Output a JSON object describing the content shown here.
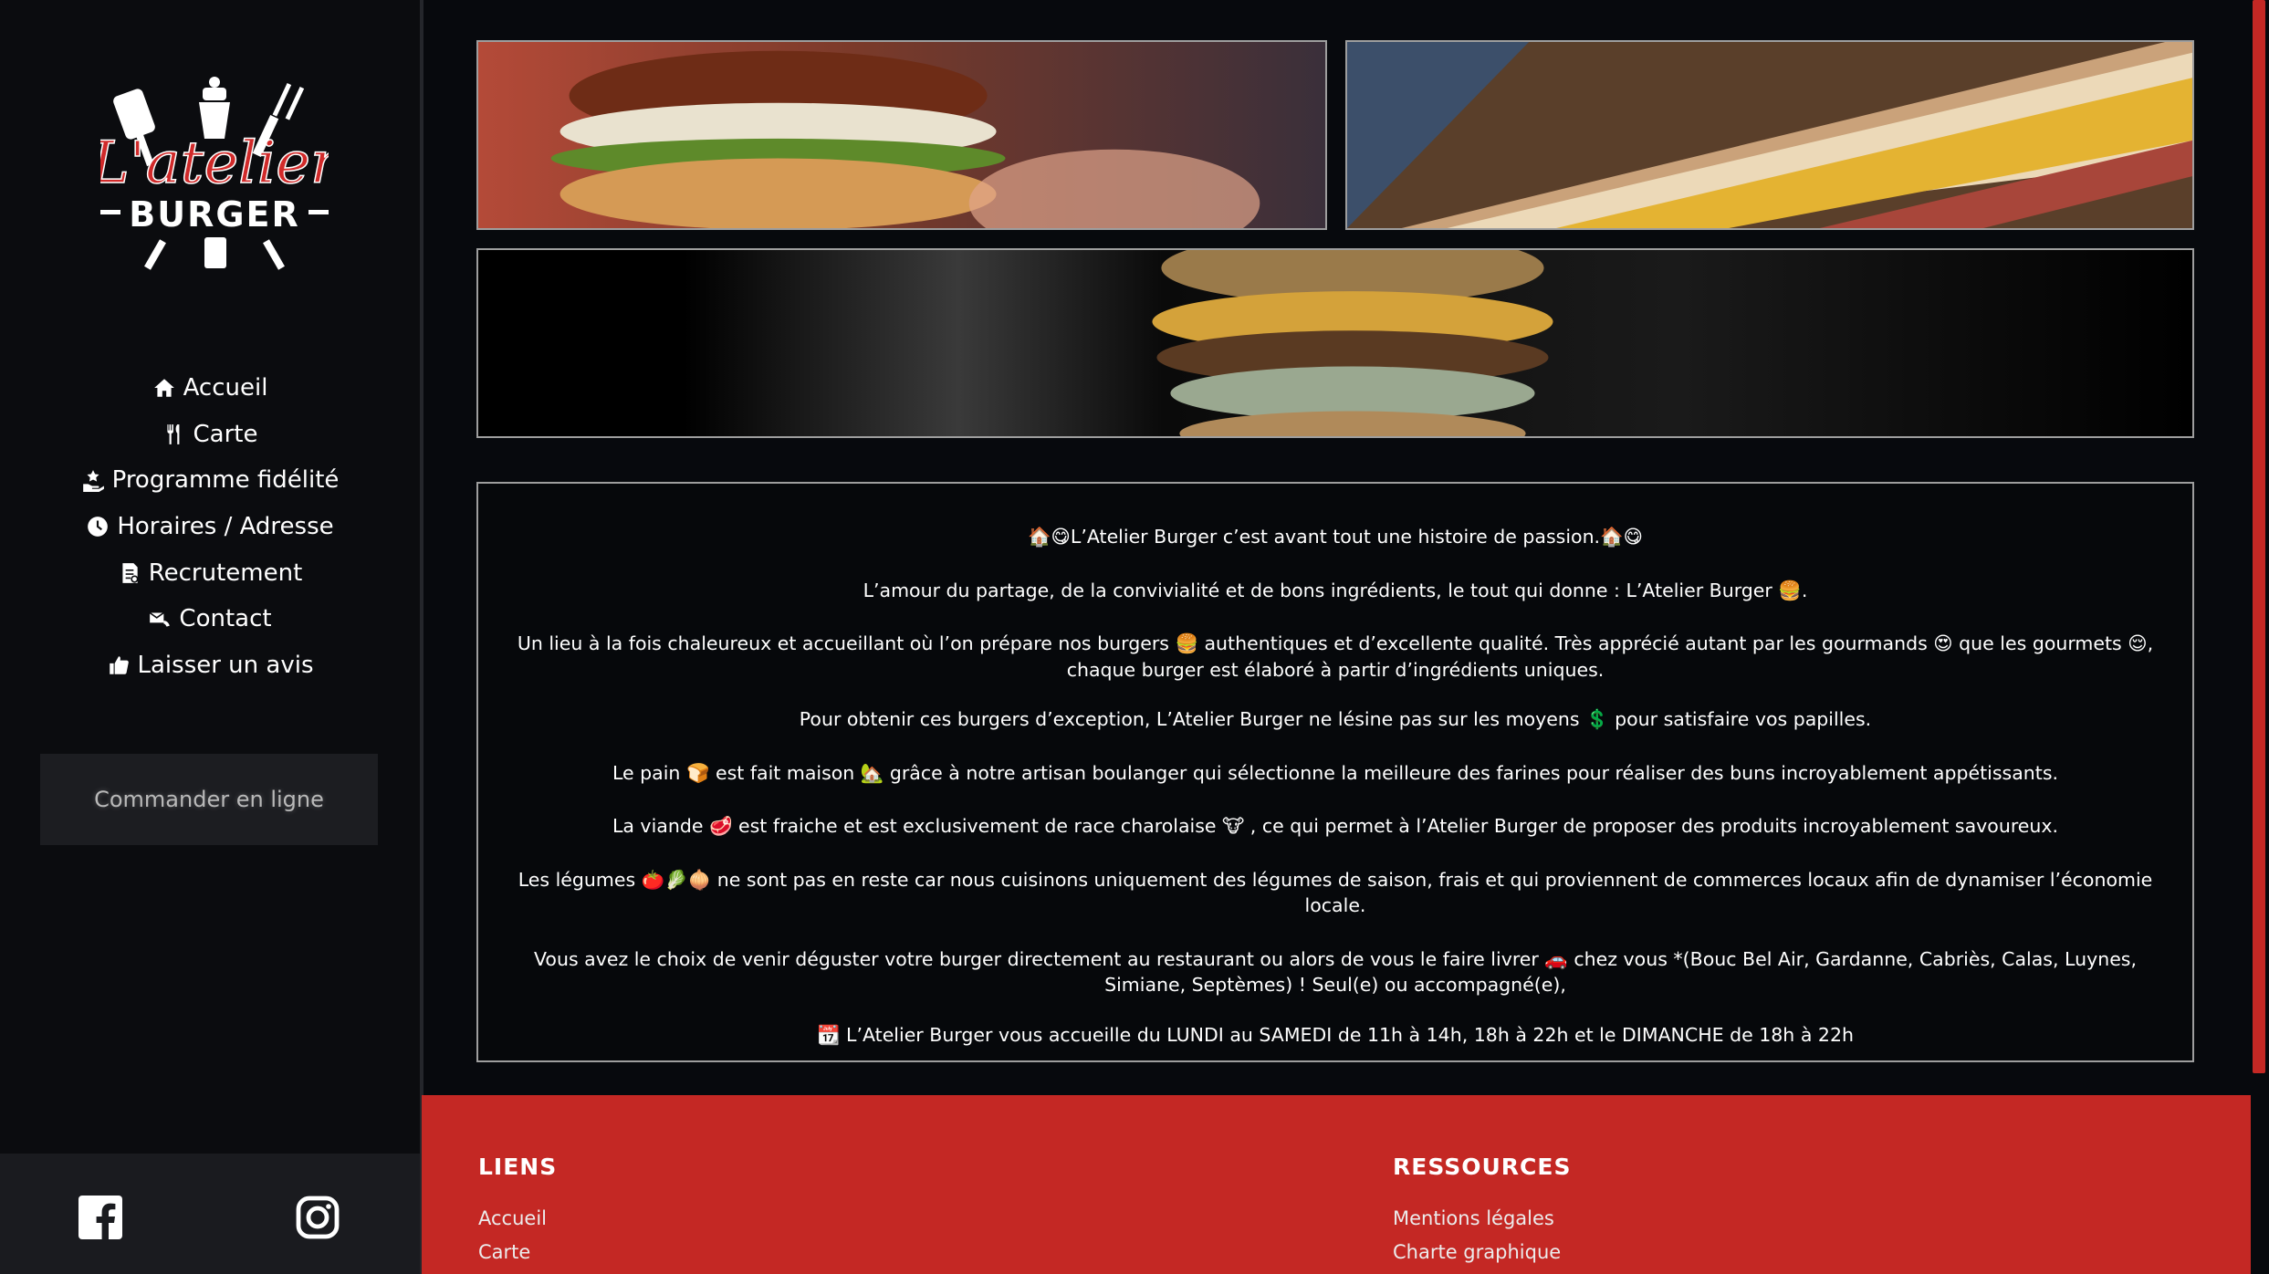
{
  "brand": {
    "logo_script": "L'atelier",
    "logo_word": "BURGER"
  },
  "nav": [
    {
      "label": "Accueil",
      "icon": "home-icon"
    },
    {
      "label": "Carte",
      "icon": "cutlery-icon"
    },
    {
      "label": "Programme fidélité",
      "icon": "loyalty-icon"
    },
    {
      "label": "Horaires / Adresse",
      "icon": "clock-icon"
    },
    {
      "label": "Recrutement",
      "icon": "resume-icon"
    },
    {
      "label": "Contact",
      "icon": "contact-icon"
    },
    {
      "label": "Laisser un avis",
      "icon": "review-icon"
    }
  ],
  "order_button": "Commander en ligne",
  "social": {
    "facebook": "facebook-icon",
    "instagram": "instagram-icon"
  },
  "story": {
    "p1": "🏠😋L’Atelier Burger c’est avant tout une histoire de passion.🏠😋",
    "p2": "L’amour du partage, de la convivialité et de bons ingrédients, le tout qui donne : L’Atelier Burger 🍔.",
    "p3": "Un lieu à la fois chaleureux et accueillant où l’on prépare nos burgers 🍔 authentiques et d’excellente qualité. Très apprécié autant par les gourmands 😍 que les gourmets 😌, chaque burger est élaboré à partir d’ingrédients uniques.",
    "p4": "Pour obtenir ces burgers d’exception, L’Atelier Burger ne lésine pas sur les moyens 💲 pour satisfaire vos papilles.",
    "p5": "Le pain 🍞 est fait maison 🏡 grâce à notre artisan boulanger qui sélectionne la meilleure des farines pour réaliser des buns incroyablement appétissants.",
    "p6": "La viande 🥩 est fraiche et est exclusivement de race charolaise 🐮 , ce qui permet à l’Atelier Burger de proposer des produits incroyablement savoureux.",
    "p7": "Les légumes 🍅🥬🧅 ne sont pas en reste car nous cuisinons uniquement des légumes de saison, frais et qui proviennent de commerces locaux afin de dynamiser l’économie locale.",
    "p8": "Vous avez le choix de venir déguster votre burger directement au restaurant ou alors de vous le faire livrer 🚗 chez vous *(Bouc Bel Air, Gardanne, Cabriès, Calas, Luynes, Simiane, Septèmes) ! Seul(e) ou accompagné(e),",
    "p9": "📆 L’Atelier Burger vous accueille du LUNDI au SAMEDI de 11h à 14h, 18h à 22h et le DIMANCHE de 18h à 22h"
  },
  "footer": {
    "liens": {
      "title": "LIENS",
      "links": [
        "Accueil",
        "Carte"
      ]
    },
    "ressources": {
      "title": "RESSOURCES",
      "links": [
        "Mentions légales",
        "Charte graphique"
      ]
    }
  },
  "colors": {
    "accent": "#c42824",
    "sidebar": "#0b0c0f",
    "page_bg": "#07090d"
  }
}
